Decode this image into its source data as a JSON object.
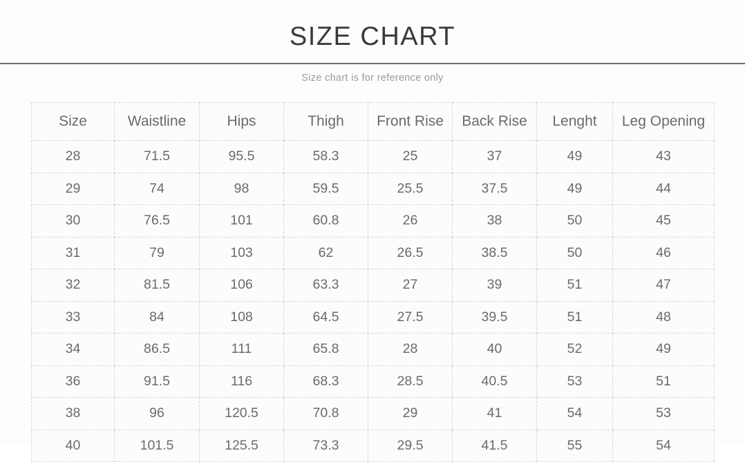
{
  "header": {
    "title": "SIZE CHART",
    "subtitle": "Size chart is for reference only"
  },
  "colors": {
    "title_text": "#3a3a3a",
    "subtitle_text": "#9a9a9a",
    "cell_text": "#6a6a6a",
    "border": "#d6d6d6",
    "rule": "#6e6e73",
    "cell_background": "#fcfcfc"
  },
  "chart_data": {
    "type": "table",
    "title": "SIZE CHART",
    "subtitle": "Size chart is for reference only",
    "columns": [
      "Size",
      "Waistline",
      "Hips",
      "Thigh",
      "Front Rise",
      "Back Rise",
      "Lenght",
      "Leg Opening"
    ],
    "rows": [
      [
        "28",
        "71.5",
        "95.5",
        "58.3",
        "25",
        "37",
        "49",
        "43"
      ],
      [
        "29",
        "74",
        "98",
        "59.5",
        "25.5",
        "37.5",
        "49",
        "44"
      ],
      [
        "30",
        "76.5",
        "101",
        "60.8",
        "26",
        "38",
        "50",
        "45"
      ],
      [
        "31",
        "79",
        "103",
        "62",
        "26.5",
        "38.5",
        "50",
        "46"
      ],
      [
        "32",
        "81.5",
        "106",
        "63.3",
        "27",
        "39",
        "51",
        "47"
      ],
      [
        "33",
        "84",
        "108",
        "64.5",
        "27.5",
        "39.5",
        "51",
        "48"
      ],
      [
        "34",
        "86.5",
        "111",
        "65.8",
        "28",
        "40",
        "52",
        "49"
      ],
      [
        "36",
        "91.5",
        "116",
        "68.3",
        "28.5",
        "40.5",
        "53",
        "51"
      ],
      [
        "38",
        "96",
        "120.5",
        "70.8",
        "29",
        "41",
        "54",
        "53"
      ],
      [
        "40",
        "101.5",
        "125.5",
        "73.3",
        "29.5",
        "41.5",
        "55",
        "54"
      ]
    ]
  }
}
